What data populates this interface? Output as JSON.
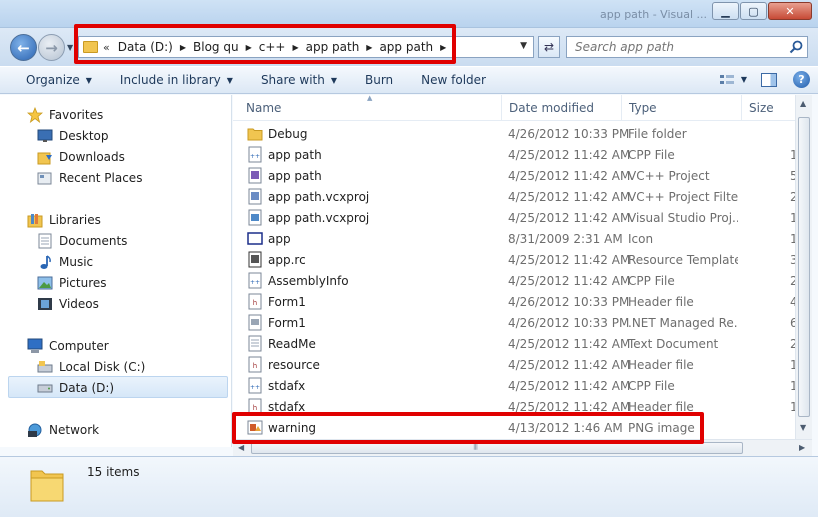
{
  "window": {
    "title": "app path - Visual ...",
    "controls": {
      "minimize": "▁",
      "maximize": "▢",
      "close": "✕"
    }
  },
  "address": {
    "lead": "«",
    "crumbs": [
      "Data (D:)",
      "Blog qu",
      "c++",
      "app path",
      "app path"
    ]
  },
  "search": {
    "placeholder": "Search app path"
  },
  "toolbar": {
    "organize": "Organize",
    "include_in_library": "Include in library",
    "share_with": "Share with",
    "burn": "Burn",
    "new_folder": "New folder",
    "help": "?"
  },
  "nav": {
    "favorites": "Favorites",
    "desktop": "Desktop",
    "downloads": "Downloads",
    "recent_places": "Recent Places",
    "libraries": "Libraries",
    "documents": "Documents",
    "music": "Music",
    "pictures": "Pictures",
    "videos": "Videos",
    "computer": "Computer",
    "local_disk": "Local Disk (C:)",
    "data_d": "Data (D:)",
    "network": "Network"
  },
  "columns": {
    "name": "Name",
    "date": "Date modified",
    "type": "Type",
    "size": "Size"
  },
  "files": [
    {
      "name": "Debug",
      "date": "4/26/2012 10:33 PM",
      "type": "File folder",
      "size": "",
      "icon": "folder-icon"
    },
    {
      "name": "app path",
      "date": "4/25/2012 11:42 AM",
      "type": "CPP File",
      "size": "1",
      "icon": "cpp-file-icon"
    },
    {
      "name": "app path",
      "date": "4/25/2012 11:42 AM",
      "type": "VC++ Project",
      "size": "5",
      "icon": "vcproj-icon"
    },
    {
      "name": "app path.vcxproj",
      "date": "4/25/2012 11:42 AM",
      "type": "VC++ Project Filte...",
      "size": "2",
      "icon": "vcproj-filters-icon"
    },
    {
      "name": "app path.vcxproj",
      "date": "4/25/2012 11:42 AM",
      "type": "Visual Studio Proj...",
      "size": "1",
      "icon": "vs-project-icon"
    },
    {
      "name": "app",
      "date": "8/31/2009 2:31 AM",
      "type": "Icon",
      "size": "1",
      "icon": "ico-file-icon"
    },
    {
      "name": "app.rc",
      "date": "4/25/2012 11:42 AM",
      "type": "Resource Template",
      "size": "3",
      "icon": "rc-file-icon"
    },
    {
      "name": "AssemblyInfo",
      "date": "4/25/2012 11:42 AM",
      "type": "CPP File",
      "size": "2",
      "icon": "cpp-file-icon"
    },
    {
      "name": "Form1",
      "date": "4/26/2012 10:33 PM",
      "type": "Header file",
      "size": "4",
      "icon": "header-file-icon"
    },
    {
      "name": "Form1",
      "date": "4/26/2012 10:33 PM",
      "type": ".NET Managed Re...",
      "size": "6",
      "icon": "resx-file-icon"
    },
    {
      "name": "ReadMe",
      "date": "4/25/2012 11:42 AM",
      "type": "Text Document",
      "size": "2",
      "icon": "text-file-icon"
    },
    {
      "name": "resource",
      "date": "4/25/2012 11:42 AM",
      "type": "Header file",
      "size": "1",
      "icon": "header-file-icon"
    },
    {
      "name": "stdafx",
      "date": "4/25/2012 11:42 AM",
      "type": "CPP File",
      "size": "1",
      "icon": "cpp-file-icon"
    },
    {
      "name": "stdafx",
      "date": "4/25/2012 11:42 AM",
      "type": "Header file",
      "size": "1",
      "icon": "header-file-icon"
    },
    {
      "name": "warning",
      "date": "4/13/2012 1:46 AM",
      "type": "PNG image",
      "size": "",
      "icon": "png-file-icon"
    }
  ],
  "status": {
    "items_count": "15 items"
  },
  "colors": {
    "highlight_red": "#e00000",
    "accent_blue": "#1e395b",
    "selection": "#d6e7f8"
  }
}
